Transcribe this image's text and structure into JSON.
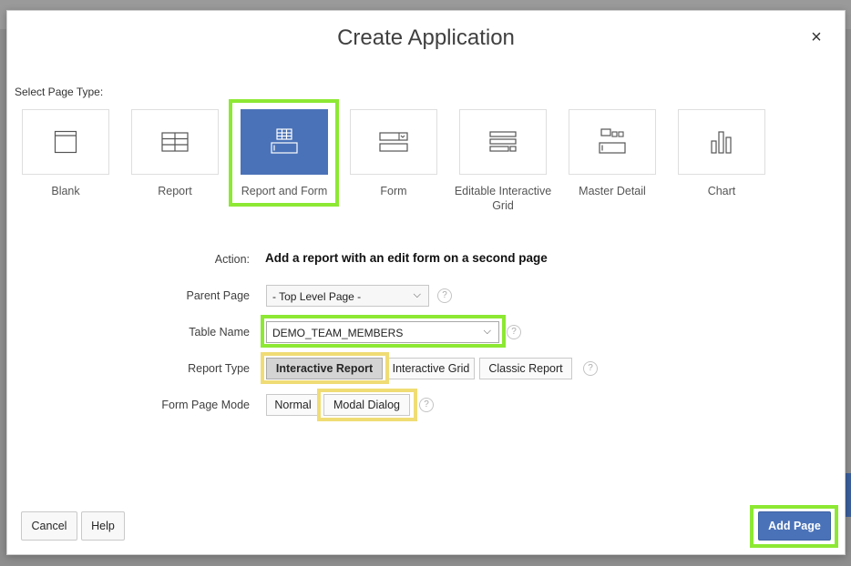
{
  "dialog": {
    "title": "Create Application",
    "close_label": "×"
  },
  "page_types": {
    "label": "Select Page Type:",
    "items": [
      {
        "label": "Blank",
        "icon": "blank-page-icon"
      },
      {
        "label": "Report",
        "icon": "report-table-icon"
      },
      {
        "label": "Report and Form",
        "icon": "report-and-form-icon",
        "selected": true
      },
      {
        "label": "Form",
        "icon": "form-icon"
      },
      {
        "label": "Editable Interactive Grid",
        "icon": "editable-grid-icon"
      },
      {
        "label": "Master Detail",
        "icon": "master-detail-icon"
      },
      {
        "label": "Chart",
        "icon": "bar-chart-icon"
      }
    ]
  },
  "form": {
    "action": {
      "label": "Action:",
      "value": "Add a report with an edit form on a second page"
    },
    "parent_page": {
      "label": "Parent Page",
      "value": "- Top Level Page -",
      "help": "?"
    },
    "table_name": {
      "label": "Table Name",
      "value": "DEMO_TEAM_MEMBERS",
      "help": "?"
    },
    "report_type": {
      "label": "Report Type",
      "options": [
        "Interactive Report",
        "Interactive Grid",
        "Classic Report"
      ],
      "selected": "Interactive Report",
      "help": "?"
    },
    "form_page_mode": {
      "label": "Form Page Mode",
      "options": [
        "Normal",
        "Modal Dialog"
      ],
      "selected": "Modal Dialog",
      "help": "?"
    }
  },
  "footer": {
    "cancel_label": "Cancel",
    "help_label": "Help",
    "add_page_label": "Add Page"
  },
  "colors": {
    "accent": "#4a72b8",
    "highlight_green": "#8de833",
    "highlight_yellow": "#f0dc75"
  }
}
